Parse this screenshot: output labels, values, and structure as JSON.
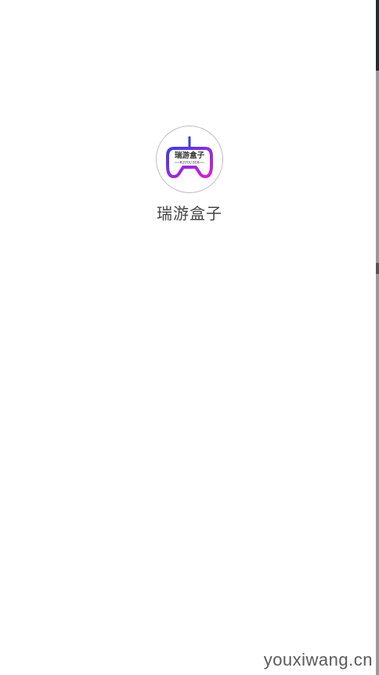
{
  "app": {
    "name": "瑞游盒子",
    "logo": {
      "icon": "gamepad-icon",
      "top_text": "瑞游盒子",
      "sub_text": "RUIYOU BOX",
      "gradient_start": "#3b3fe0",
      "gradient_end": "#e11bd0"
    }
  },
  "watermark": "youxiwang.cn"
}
